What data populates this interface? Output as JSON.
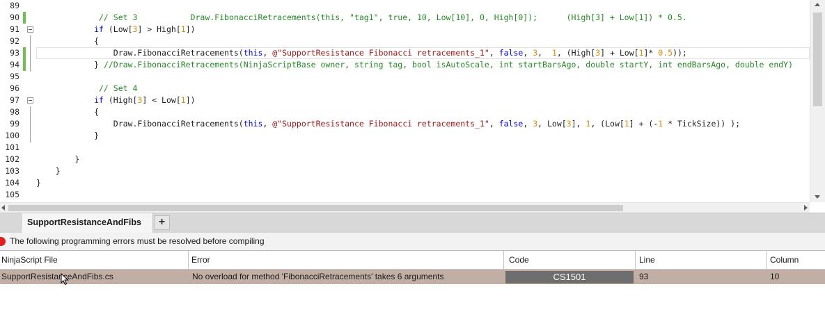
{
  "editor": {
    "lines": [
      {
        "n": "89",
        "code": ""
      },
      {
        "n": "90",
        "code": "             // Set 3           Draw.FibonacciRetracements(this, \"tag1\", true, 10, Low[10], 0, High[0]);      (High[3] + Low[1]) * 0.5."
      },
      {
        "n": "91",
        "code": "            if (Low[3] > High[1])"
      },
      {
        "n": "92",
        "code": "            {"
      },
      {
        "n": "93",
        "code": "                Draw.FibonacciRetracements(this, @\"SupportResistance Fibonacci retracements_1\", false, 3,  1, (High[3] + Low[1]* 0.5));"
      },
      {
        "n": "94",
        "code": "            } //Draw.FibonacciRetracements(NinjaScriptBase owner, string tag, bool isAutoScale, int startBarsAgo, double startY, int endBarsAgo, double endY)"
      },
      {
        "n": "95",
        "code": ""
      },
      {
        "n": "96",
        "code": "             // Set 4"
      },
      {
        "n": "97",
        "code": "            if (High[3] < Low[1])"
      },
      {
        "n": "98",
        "code": "            {"
      },
      {
        "n": "99",
        "code": "                Draw.FibonacciRetracements(this, @\"SupportResistance Fibonacci retracements_1\", false, 3, Low[3], 1, (Low[1] + (-1 * TickSize)) );"
      },
      {
        "n": "100",
        "code": "            }"
      },
      {
        "n": "101",
        "code": ""
      },
      {
        "n": "102",
        "code": "        }"
      },
      {
        "n": "103",
        "code": "    }"
      },
      {
        "n": "104",
        "code": "}"
      },
      {
        "n": "105",
        "code": ""
      }
    ]
  },
  "tabs": {
    "active_label": "SupportResistanceAndFibs",
    "add_label": "+"
  },
  "status": {
    "message": "The following programming errors must be resolved before compiling"
  },
  "error_table": {
    "headers": [
      "NinjaScript File",
      "Error",
      "Code",
      "Line",
      "Column"
    ],
    "rows": [
      {
        "file": "SupportResistanceAndFibs.cs",
        "error": "No overload for method 'FibonacciRetracements' takes 6 arguments",
        "code": "CS1501",
        "line": "93",
        "column": "10"
      }
    ]
  },
  "colors": {
    "error_row": "#c1aea5",
    "error_dot": "#e11f1f",
    "change_marker": "#6cc24a"
  }
}
